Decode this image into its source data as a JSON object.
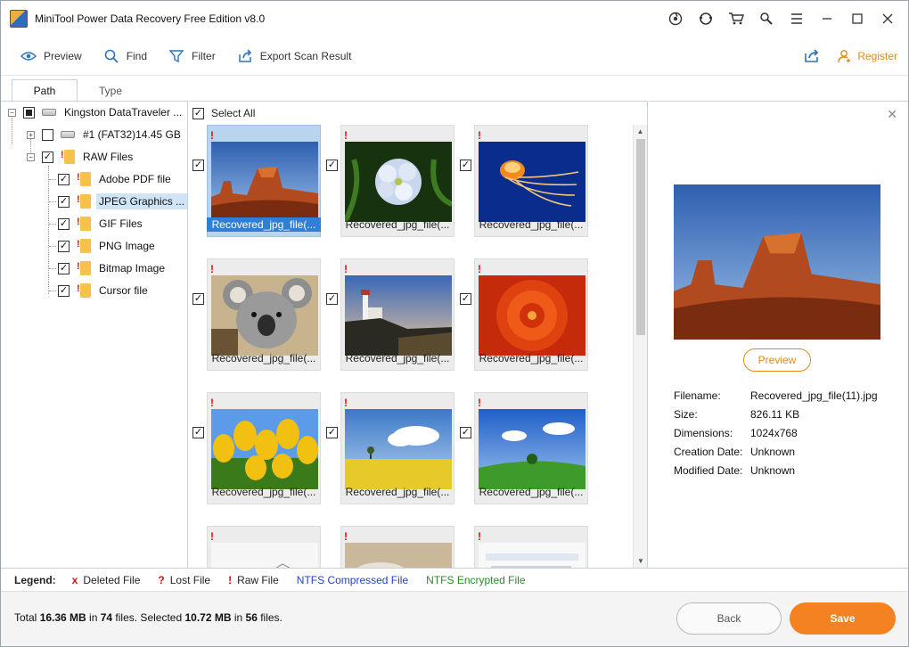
{
  "window": {
    "title": "MiniTool Power Data Recovery Free Edition v8.0"
  },
  "titlebar_icons": [
    "mini-tool-logo-icon",
    "support-icon",
    "cart-icon",
    "key-icon",
    "menu-icon",
    "minimize-icon",
    "maximize-icon",
    "close-icon"
  ],
  "toolbar": {
    "preview": "Preview",
    "find": "Find",
    "filter": "Filter",
    "export": "Export Scan Result",
    "register": "Register"
  },
  "tabs": [
    {
      "label": "Path",
      "active": true
    },
    {
      "label": "Type",
      "active": false
    }
  ],
  "tree": {
    "root": "Kingston DataTraveler ...",
    "partition": "#1 (FAT32)14.45 GB",
    "raw": "RAW Files",
    "items": [
      "Adobe PDF file",
      "JPEG Graphics ...",
      "GIF Files",
      "PNG Image",
      "Bitmap Image",
      "Cursor file"
    ],
    "selected_index": 1
  },
  "grid": {
    "select_all": "Select All",
    "items": [
      {
        "caption": "Recovered_jpg_file(...",
        "scene": "desert",
        "checked": true,
        "selected": true
      },
      {
        "caption": "Recovered_jpg_file(...",
        "scene": "flower",
        "checked": true
      },
      {
        "caption": "Recovered_jpg_file(...",
        "scene": "jellyfish",
        "checked": true
      },
      {
        "caption": "Recovered_jpg_file(...",
        "scene": "koala",
        "checked": true
      },
      {
        "caption": "Recovered_jpg_file(...",
        "scene": "lighthouse",
        "checked": true
      },
      {
        "caption": "Recovered_jpg_file(...",
        "scene": "chrysanthemum",
        "checked": true
      },
      {
        "caption": "Recovered_jpg_file(...",
        "scene": "tulips",
        "checked": true
      },
      {
        "caption": "Recovered_jpg_file(...",
        "scene": "field",
        "checked": true
      },
      {
        "caption": "Recovered_jpg_file(...",
        "scene": "meadow",
        "checked": true
      },
      {
        "caption": "",
        "scene": "sketch",
        "checked": false
      },
      {
        "caption": "",
        "scene": "clouds",
        "checked": false
      },
      {
        "caption": "",
        "scene": "document",
        "checked": false
      }
    ]
  },
  "preview": {
    "button": "Preview",
    "info": [
      {
        "key": "Filename:",
        "value": "Recovered_jpg_file(11).jpg"
      },
      {
        "key": "Size:",
        "value": "826.11 KB"
      },
      {
        "key": "Dimensions:",
        "value": "1024x768"
      },
      {
        "key": "Creation Date:",
        "value": "Unknown"
      },
      {
        "key": "Modified Date:",
        "value": "Unknown"
      }
    ]
  },
  "legend": {
    "title": "Legend:",
    "items": [
      {
        "symbol": "x",
        "label": "Deleted File",
        "color": "#d11111"
      },
      {
        "symbol": "?",
        "label": "Lost File",
        "color": "#d11111"
      },
      {
        "symbol": "!",
        "label": "Raw File",
        "color": "#d11111"
      },
      {
        "symbol": "",
        "label": "NTFS Compressed File",
        "color": "#1f3fd1"
      },
      {
        "symbol": "",
        "label": "NTFS Encrypted File",
        "color": "#2a8a2a"
      }
    ]
  },
  "status": {
    "pre": "Total ",
    "total_size": "16.36 MB",
    "mid1": " in ",
    "total_files": "74",
    "mid2": " files.  Selected ",
    "selected_size": "10.72 MB",
    "mid3": " in ",
    "selected_files": "56",
    "post": " files."
  },
  "buttons": {
    "back": "Back",
    "save": "Save"
  },
  "colors": {
    "accent": "#f58220",
    "selection": "#2f7fd6"
  }
}
